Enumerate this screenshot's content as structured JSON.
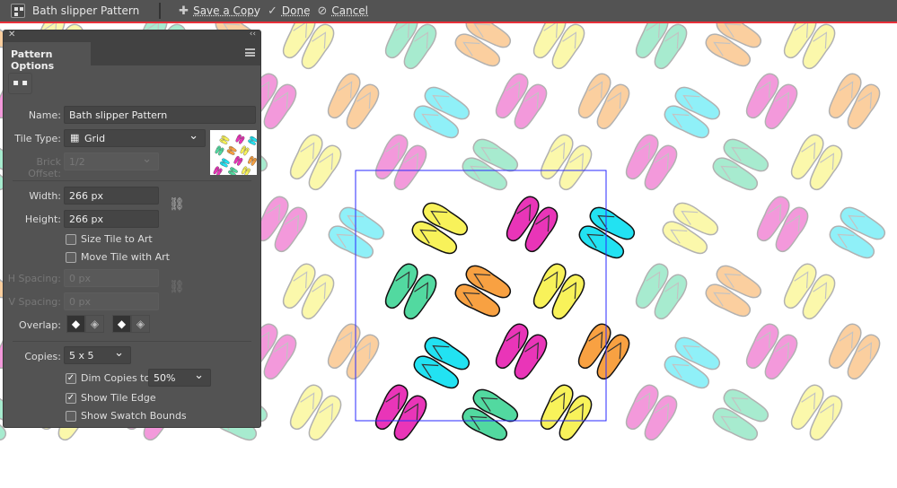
{
  "topbar": {
    "title": "Bath slipper Pattern",
    "save_copy": "Save a Copy",
    "done": "Done",
    "cancel": "Cancel",
    "icons": {
      "save": "plus-icon",
      "done": "checkmark-icon",
      "cancel": "cancel-icon"
    }
  },
  "panel": {
    "title": "Pattern Options",
    "name_label": "Name:",
    "name_value": "Bath slipper Pattern",
    "tile_type_label": "Tile Type:",
    "tile_type_value": "Grid",
    "brick_offset_label": "Brick Offset:",
    "brick_offset_value": "1/2",
    "width_label": "Width:",
    "width_value": "266 px",
    "height_label": "Height:",
    "height_value": "266 px",
    "size_tile": "Size Tile to Art",
    "size_tile_checked": false,
    "move_tile": "Move Tile with Art",
    "move_tile_checked": false,
    "hspacing_label": "H Spacing:",
    "hspacing_value": "0 px",
    "vspacing_label": "V Spacing:",
    "vspacing_value": "0 px",
    "overlap_label": "Overlap:",
    "copies_label": "Copies:",
    "copies_value": "5 x 5",
    "dim_label": "Dim Copies to:",
    "dim_checked": true,
    "dim_value": "50%",
    "show_tile_edge": "Show Tile Edge",
    "show_tile_edge_checked": true,
    "show_swatch_bounds": "Show Swatch Bounds",
    "show_swatch_bounds_checked": false
  },
  "colors": {
    "yellow": "#f8f25a",
    "magenta": "#e935b8",
    "cyan": "#22e2f2",
    "green": "#52d9a0",
    "orange": "#f8a142",
    "tile_edge": "#2a2aff",
    "accent_line": "#e8303a"
  }
}
